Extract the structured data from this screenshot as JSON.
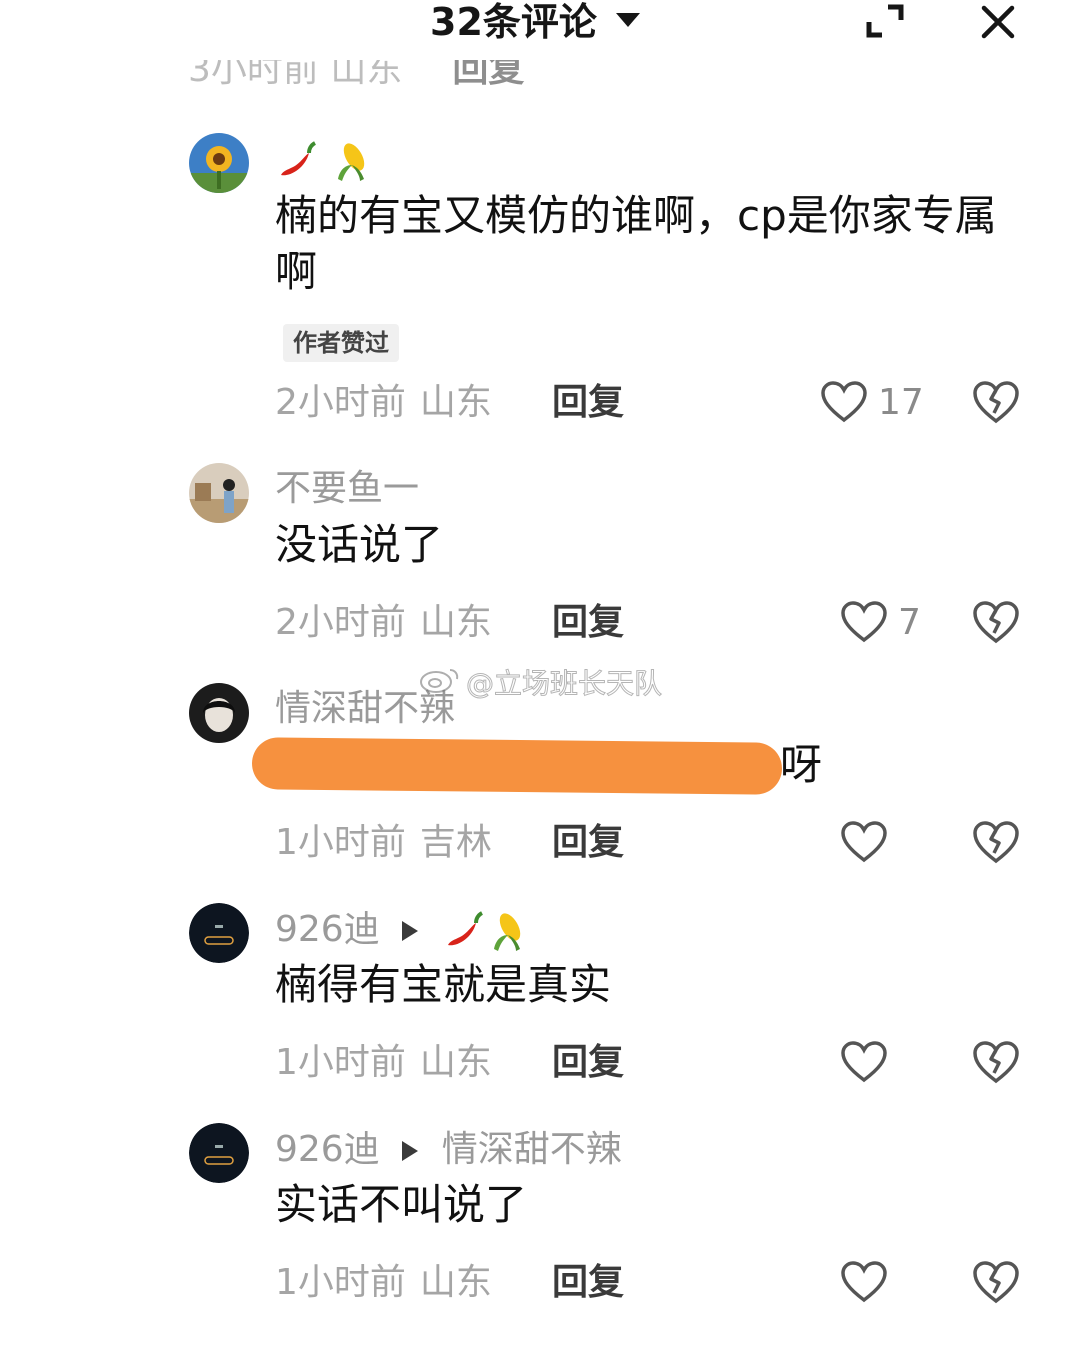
{
  "header": {
    "title": "32条评论"
  },
  "comments": [
    {
      "name": "",
      "text": "楠的有宝又模仿的谁啊，cp是你家专属啊",
      "badge": "作者赞过",
      "time": "2小时前",
      "location": "山东",
      "reply": "回复",
      "likes": "17"
    },
    {
      "name": "不要鱼一",
      "text": "没话说了",
      "time": "2小时前",
      "location": "山东",
      "reply": "回复",
      "likes": "7"
    },
    {
      "name": "情深甜不辣",
      "text": "呀",
      "time": "1小时前",
      "location": "吉林",
      "reply": "回复",
      "likes": ""
    },
    {
      "name": "926迪",
      "text": "楠得有宝就是真实",
      "time": "1小时前",
      "location": "山东",
      "reply": "回复",
      "likes": ""
    },
    {
      "name": "926迪",
      "reply_to": "情深甜不辣",
      "text": "实话不叫说了",
      "time": "1小时前",
      "location": "山东",
      "reply": "回复",
      "likes": ""
    }
  ],
  "watermark": "@立场班长天队",
  "icons": [
    "expand-icon",
    "close-icon",
    "heart-icon",
    "broken-heart-icon",
    "chili-emoji",
    "corn-emoji",
    "reply-arrow-icon"
  ],
  "colors": {
    "redaction": "#f6913f",
    "meta_gray": "#a5a5a5"
  }
}
